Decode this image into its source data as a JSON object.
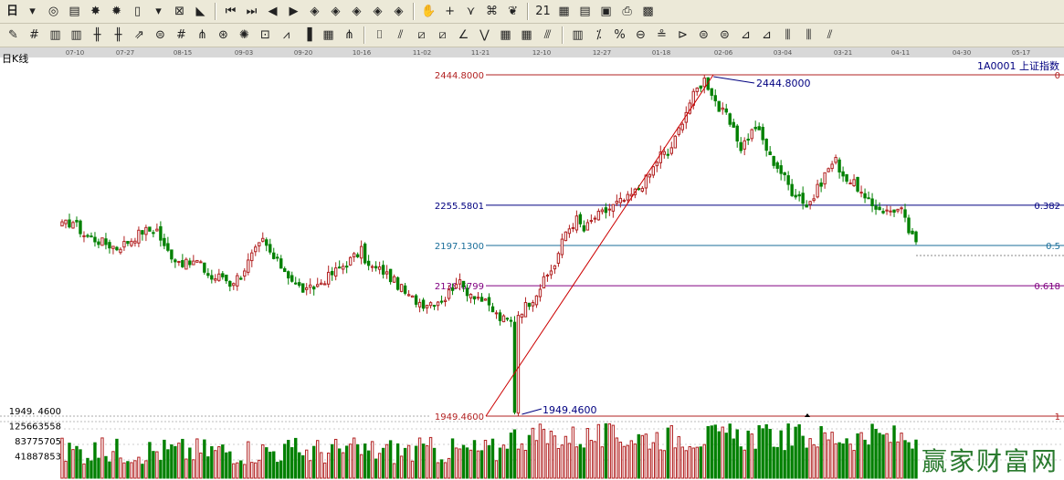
{
  "toolbar1": {
    "buttons": [
      {
        "name": "period-selector",
        "label": "日"
      },
      {
        "name": "dropdown-arrow-icon",
        "label": "▾"
      },
      {
        "name": "chart-style-icon",
        "label": "◎"
      },
      {
        "name": "document-icon",
        "label": "▤"
      },
      {
        "name": "indicator-icon",
        "label": "✸"
      },
      {
        "name": "multi-indicator-icon",
        "label": "✹"
      },
      {
        "name": "bar-type-icon",
        "label": "▯"
      },
      {
        "name": "bar-type-dropdown-icon",
        "label": "▾"
      },
      {
        "name": "cross-cursor-icon",
        "label": "⊠"
      },
      {
        "name": "flag-icon",
        "label": "◣"
      },
      {
        "name": "sep"
      },
      {
        "name": "first-page-icon",
        "label": "⏮"
      },
      {
        "name": "last-page-icon",
        "label": "⏭"
      },
      {
        "name": "move-left-icon",
        "label": "◀"
      },
      {
        "name": "move-right-icon",
        "label": "▶"
      },
      {
        "name": "zoom-in-icon",
        "label": "◈"
      },
      {
        "name": "zoom-out-icon",
        "label": "◈"
      },
      {
        "name": "expand-icon",
        "label": "◈"
      },
      {
        "name": "shrink-icon",
        "label": "◈"
      },
      {
        "name": "fit-icon",
        "label": "◈"
      },
      {
        "name": "sep"
      },
      {
        "name": "hand-icon",
        "label": "✋"
      },
      {
        "name": "crosshair-icon",
        "label": "+"
      },
      {
        "name": "trend-icon",
        "label": "⋎"
      },
      {
        "name": "network-icon",
        "label": "⌘"
      },
      {
        "name": "link-icon",
        "label": "❦"
      },
      {
        "name": "sep"
      },
      {
        "name": "calendar-icon",
        "label": "21"
      },
      {
        "name": "calculator-icon",
        "label": "▦"
      },
      {
        "name": "notes-icon",
        "label": "▤"
      },
      {
        "name": "save-icon",
        "label": "▣"
      },
      {
        "name": "print-icon",
        "label": "⎙"
      },
      {
        "name": "broadcast-icon",
        "label": "▩"
      }
    ]
  },
  "toolbar2": {
    "buttons": [
      {
        "name": "pencil-icon",
        "label": "✎"
      },
      {
        "name": "hash-icon",
        "label": "#"
      },
      {
        "name": "grid-icon",
        "label": "▥"
      },
      {
        "name": "grid-alt-icon",
        "label": "▥"
      },
      {
        "name": "ladder-icon",
        "label": "╫"
      },
      {
        "name": "ladder-alt-icon",
        "label": "╫"
      },
      {
        "name": "arrow-tool-icon",
        "label": "⇗"
      },
      {
        "name": "circle-grid-icon",
        "label": "⊜"
      },
      {
        "name": "hash-alt-icon",
        "label": "#"
      },
      {
        "name": "fork-icon",
        "label": "⋔"
      },
      {
        "name": "target-icon",
        "label": "⊛"
      },
      {
        "name": "sun-icon",
        "label": "✺"
      },
      {
        "name": "box-tool-icon",
        "label": "⊡"
      },
      {
        "name": "angle-tool-icon",
        "label": "⩘"
      },
      {
        "name": "bars-tool-icon",
        "label": "▐"
      },
      {
        "name": "table-tool-icon",
        "label": "▦"
      },
      {
        "name": "fork-alt-icon",
        "label": "⋔"
      },
      {
        "name": "sep"
      },
      {
        "name": "bracket-icon",
        "label": "⌷"
      },
      {
        "name": "fan-icon",
        "label": "⫽"
      },
      {
        "name": "box-diagonal-icon",
        "label": "⧄"
      },
      {
        "name": "box-diagonal-alt-icon",
        "label": "⧄"
      },
      {
        "name": "line-tool-icon",
        "label": "∠"
      },
      {
        "name": "wave-icon",
        "label": "⋁"
      },
      {
        "name": "square-grid-icon",
        "label": "▦"
      },
      {
        "name": "square-grid-alt-icon",
        "label": "▦"
      },
      {
        "name": "parallel-lines-icon",
        "label": "⫻"
      },
      {
        "name": "sep"
      },
      {
        "name": "ruler-icon",
        "label": "▥"
      },
      {
        "name": "percent-fan-icon",
        "label": "⁒"
      },
      {
        "name": "percent-icon",
        "label": "%"
      },
      {
        "name": "ellipse-icon",
        "label": "⊖"
      },
      {
        "name": "level-icon",
        "label": "≗"
      },
      {
        "name": "speed-icon",
        "label": "⊳"
      },
      {
        "name": "gold-icon",
        "label": "⊜"
      },
      {
        "name": "gold-alt-icon",
        "label": "⊜"
      },
      {
        "name": "diff-icon",
        "label": "⊿"
      },
      {
        "name": "diff-alt-icon",
        "label": "⊿"
      },
      {
        "name": "cycle-icon",
        "label": "⫼"
      },
      {
        "name": "cycle-alt-icon",
        "label": "⫼"
      },
      {
        "name": "arc-icon",
        "label": "⫽"
      }
    ]
  },
  "chart_header": {
    "period_label": "日K线",
    "instrument": "1A0001 上证指数",
    "date_ticks": [
      "07-10",
      "07-27",
      "08-15",
      "09-03",
      "09-20",
      "10-16",
      "11-02",
      "11-21",
      "12-10",
      "12-27",
      "01-18",
      "02-06",
      "03-04",
      "03-21",
      "04-11",
      "04-30",
      "05-17"
    ]
  },
  "fibonacci": {
    "levels": [
      {
        "price_label": "2444.8000",
        "ratio_label": "0",
        "price": 2444.8,
        "color": "#b22222"
      },
      {
        "price_label": "2255.5801",
        "ratio_label": "0.382",
        "price": 2255.5801,
        "color": "#000080"
      },
      {
        "price_label": "2197.1300",
        "ratio_label": "0.5",
        "price": 2197.13,
        "color": "#1a6e9a"
      },
      {
        "price_label": "2138.6799",
        "ratio_label": "0.618",
        "price": 2138.6799,
        "color": "#800080"
      },
      {
        "price_label": "1949.4600",
        "ratio_label": "1",
        "price": 1949.46,
        "color": "#b22222"
      }
    ],
    "high_annotation": "2444.8000",
    "low_annotation": "1949.4600"
  },
  "volume_axis": {
    "labels": [
      "1949. 4600",
      "125663558",
      "83775705",
      "41887853"
    ]
  },
  "watermark": "赢家财富网",
  "chart_data": {
    "type": "candlestick",
    "title": "1A0001 上证指数",
    "ylim": [
      1940,
      2445
    ],
    "grid": false,
    "legend": "none",
    "waypoints": [
      [
        0,
        2226
      ],
      [
        3,
        2232
      ],
      [
        6,
        2213
      ],
      [
        10,
        2204
      ],
      [
        15,
        2194
      ],
      [
        19,
        2206
      ],
      [
        22,
        2218
      ],
      [
        26,
        2220
      ],
      [
        28,
        2194
      ],
      [
        31,
        2178
      ],
      [
        34,
        2170
      ],
      [
        37,
        2174
      ],
      [
        41,
        2149
      ],
      [
        44,
        2153
      ],
      [
        46,
        2142
      ],
      [
        49,
        2155
      ],
      [
        52,
        2182
      ],
      [
        55,
        2203
      ],
      [
        58,
        2178
      ],
      [
        61,
        2162
      ],
      [
        64,
        2140
      ],
      [
        67,
        2130
      ],
      [
        70,
        2140
      ],
      [
        74,
        2156
      ],
      [
        78,
        2172
      ],
      [
        82,
        2189
      ],
      [
        84,
        2166
      ],
      [
        88,
        2160
      ],
      [
        92,
        2140
      ],
      [
        95,
        2122
      ],
      [
        99,
        2113
      ],
      [
        102,
        2116
      ],
      [
        105,
        2121
      ],
      [
        108,
        2146
      ],
      [
        111,
        2131
      ],
      [
        114,
        2123
      ],
      [
        117,
        2108
      ],
      [
        120,
        2091
      ],
      [
        123,
        2087
      ],
      [
        126,
        2104
      ],
      [
        129,
        2121
      ],
      [
        132,
        2145
      ],
      [
        135,
        2170
      ],
      [
        138,
        2217
      ],
      [
        141,
        2235
      ],
      [
        143,
        2219
      ],
      [
        146,
        2238
      ],
      [
        149,
        2247
      ],
      [
        152,
        2258
      ],
      [
        155,
        2265
      ],
      [
        158,
        2280
      ],
      [
        161,
        2300
      ],
      [
        164,
        2330
      ],
      [
        166,
        2330
      ],
      [
        168,
        2351
      ],
      [
        170,
        2380
      ],
      [
        172,
        2405
      ],
      [
        174,
        2424
      ],
      [
        176,
        2438
      ],
      [
        178,
        2420
      ],
      [
        180,
        2395
      ],
      [
        182,
        2385
      ],
      [
        184,
        2362
      ],
      [
        186,
        2340
      ],
      [
        188,
        2355
      ],
      [
        190,
        2370
      ],
      [
        192,
        2350
      ],
      [
        194,
        2325
      ],
      [
        196,
        2312
      ],
      [
        198,
        2295
      ],
      [
        200,
        2276
      ],
      [
        202,
        2270
      ],
      [
        204,
        2255
      ],
      [
        206,
        2268
      ],
      [
        208,
        2290
      ],
      [
        210,
        2310
      ],
      [
        212,
        2320
      ],
      [
        214,
        2300
      ],
      [
        216,
        2290
      ],
      [
        218,
        2282
      ],
      [
        220,
        2262
      ],
      [
        222,
        2255
      ],
      [
        224,
        2252
      ],
      [
        226,
        2246
      ],
      [
        228,
        2250
      ],
      [
        230,
        2247
      ],
      [
        232,
        2218
      ],
      [
        234,
        2199
      ]
    ],
    "candles": [],
    "volume": [],
    "fib_high": 2444.8,
    "fib_low": 1949.46
  }
}
